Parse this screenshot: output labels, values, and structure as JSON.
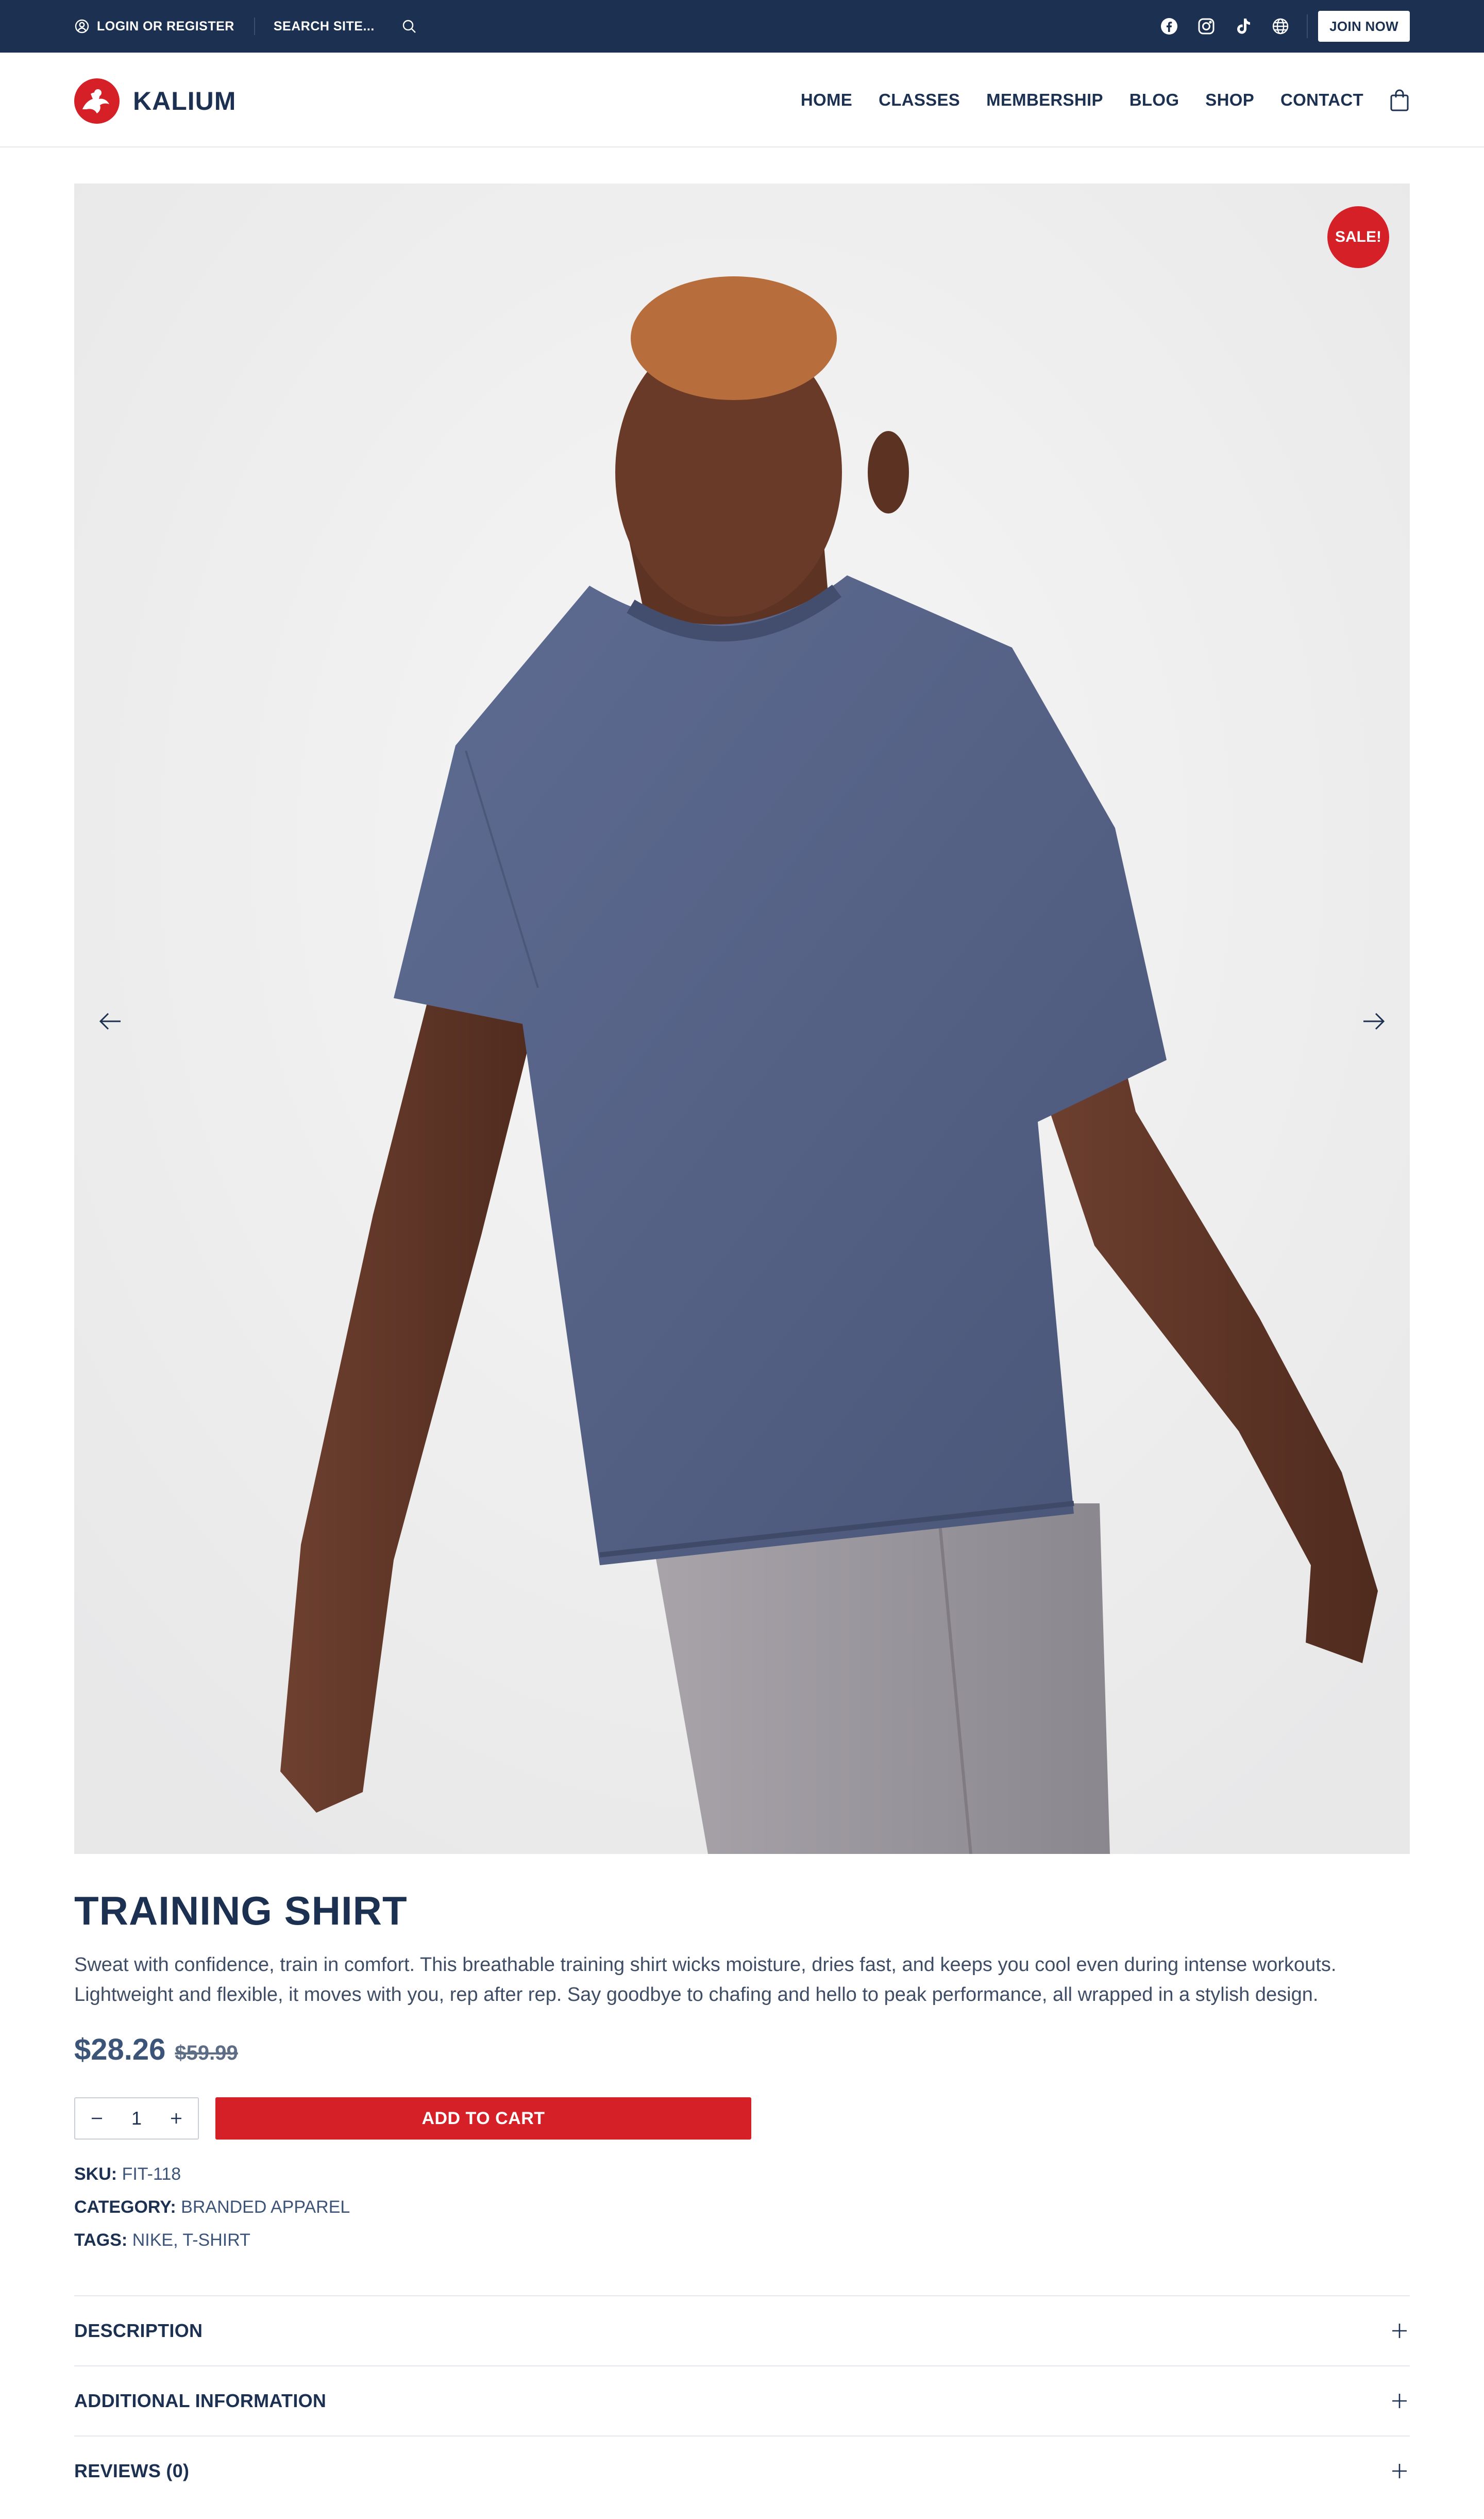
{
  "topbar": {
    "login_label": "LOGIN OR REGISTER",
    "search_label": "SEARCH SITE...",
    "join_label": "JOIN NOW",
    "socials": [
      "facebook-icon",
      "instagram-icon",
      "tiktok-icon",
      "globe-icon"
    ]
  },
  "header": {
    "logo_text": "KALIUM",
    "nav": [
      "HOME",
      "CLASSES",
      "MEMBERSHIP",
      "BLOG",
      "SHOP",
      "CONTACT"
    ]
  },
  "product": {
    "sale_badge": "SALE!",
    "title": "TRAINING SHIRT",
    "description": "Sweat with confidence, train in comfort. This breathable training shirt wicks moisture, dries fast, and keeps you cool even during intense workouts. Lightweight and flexible, it moves with you, rep after rep. Say goodbye to chafing and hello to peak performance, all wrapped in a stylish design.",
    "price": "$28.26",
    "old_price": "$59.99",
    "quantity": "1",
    "add_to_cart": "ADD TO CART",
    "sku_label": "SKU:",
    "sku": "FIT-118",
    "category_label": "CATEGORY:",
    "category": "BRANDED APPAREL",
    "tags_label": "TAGS:",
    "tags": [
      "NIKE",
      "T-SHIRT"
    ]
  },
  "accordion": [
    "DESCRIPTION",
    "ADDITIONAL INFORMATION",
    "REVIEWS (0)"
  ],
  "colors": {
    "navy": "#1c3151",
    "accent_red": "#d62027",
    "shirt": "#56638a",
    "pants": "#97939a"
  }
}
